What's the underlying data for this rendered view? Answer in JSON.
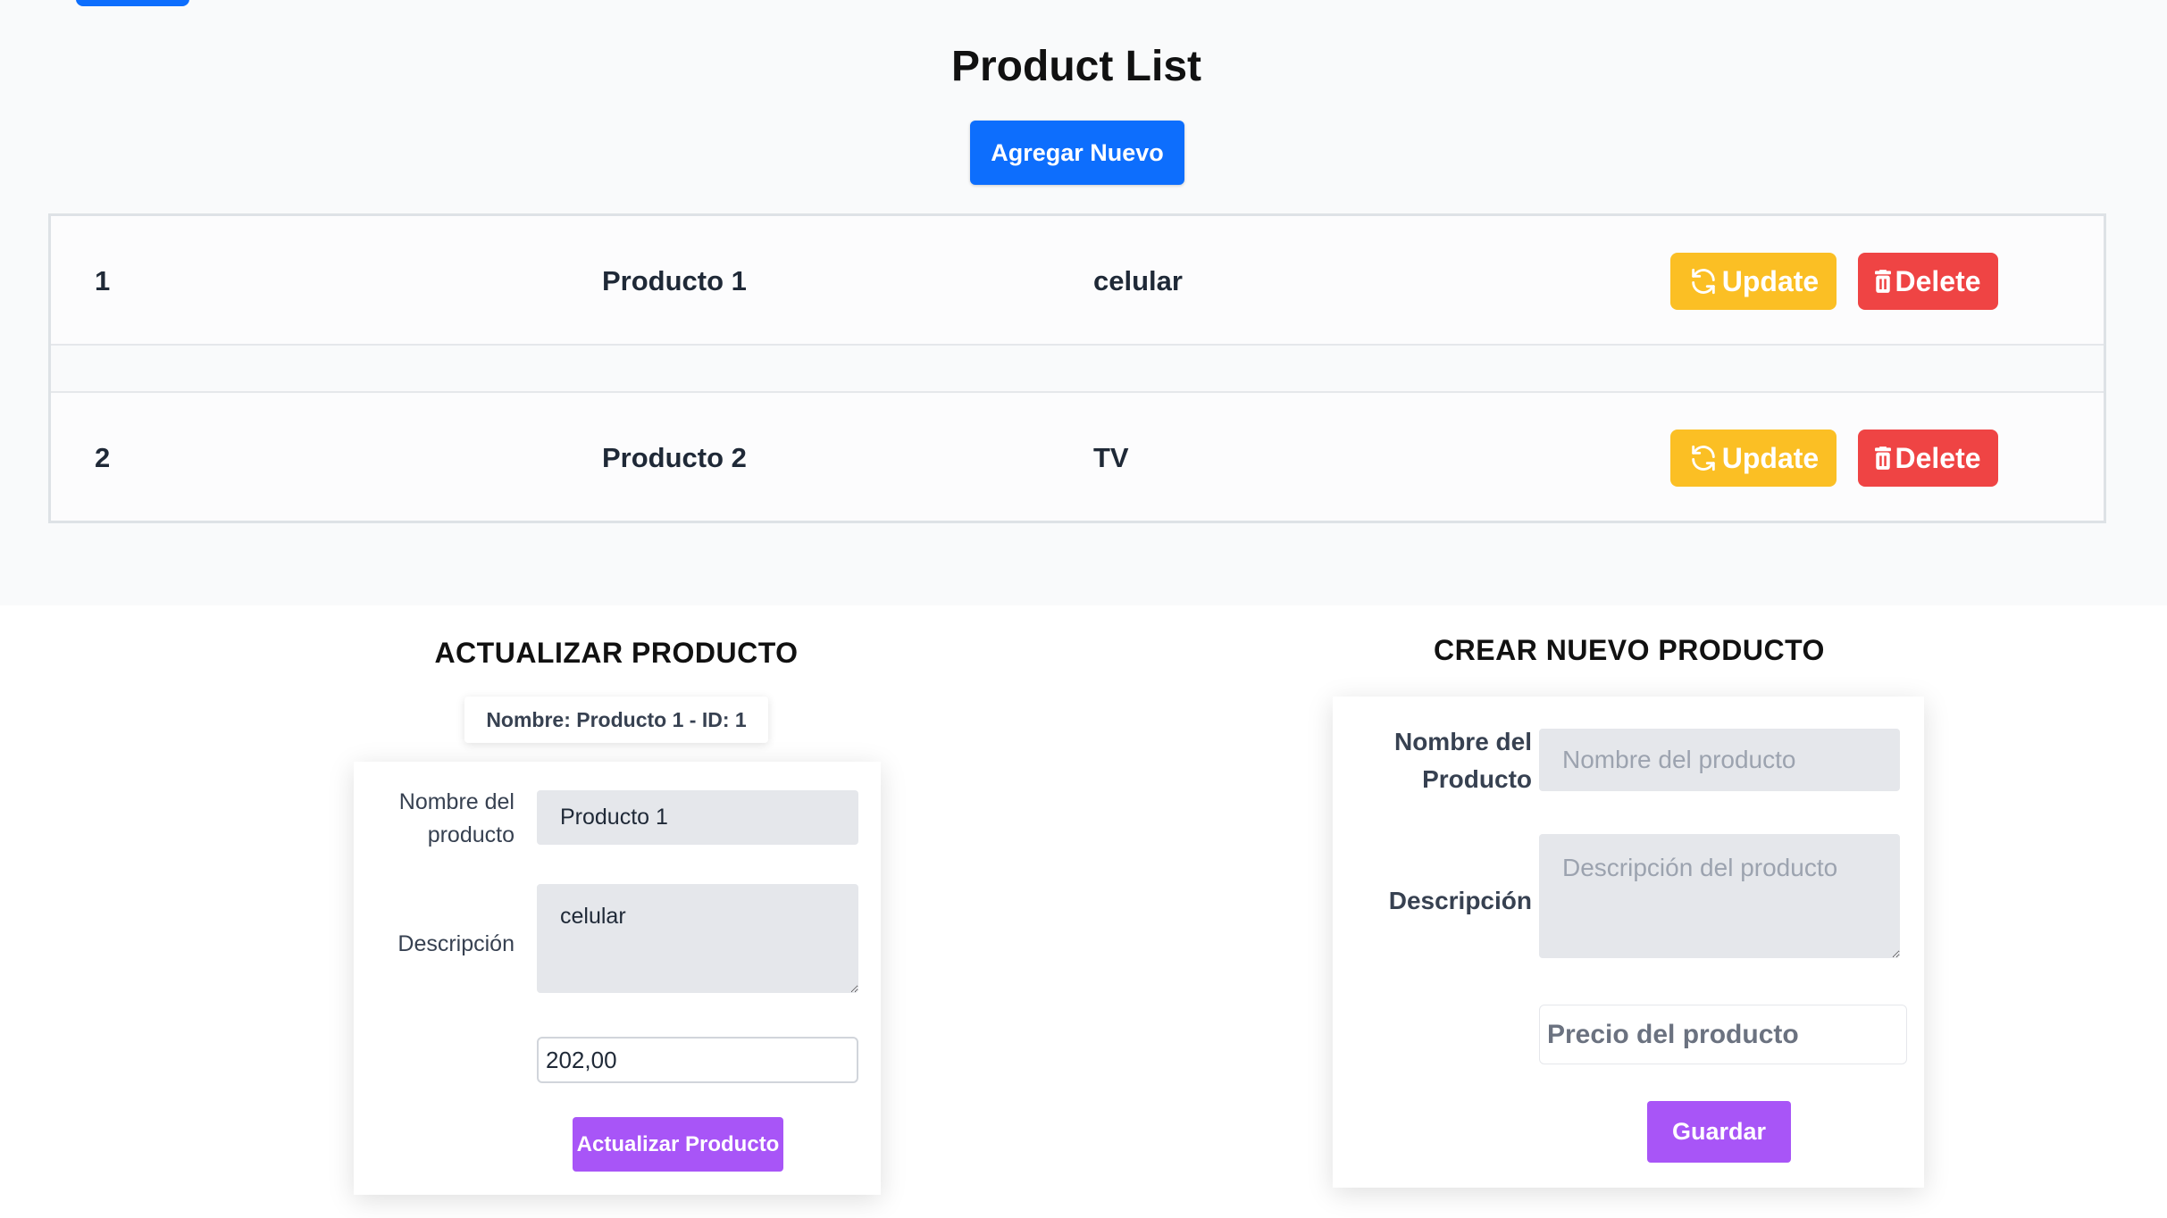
{
  "page": {
    "title": "Product List",
    "add_button": "Agregar Nuevo"
  },
  "products": [
    {
      "id": "1",
      "name": "Producto 1",
      "description": "celular",
      "update_label": "Update",
      "delete_label": "Delete"
    },
    {
      "id": "2",
      "name": "Producto 2",
      "description": "TV",
      "update_label": "Update",
      "delete_label": "Delete"
    }
  ],
  "update_form": {
    "title": "ACTUALIZAR PRODUCTO",
    "badge": "Nombre: Producto 1 - ID: 1",
    "name_label": "Nombre del producto",
    "name_value": "Producto 1",
    "description_label": "Descripción",
    "description_value": "celular",
    "price_value": "202,00",
    "submit_label": "Actualizar Producto"
  },
  "create_form": {
    "title": "CREAR NUEVO PRODUCTO",
    "name_label": "Nombre del Producto",
    "name_placeholder": "Nombre del producto",
    "description_label": "Descripción",
    "description_placeholder": "Descripción del producto",
    "price_placeholder": "Precio del producto",
    "submit_label": "Guardar"
  },
  "colors": {
    "primary": "#0d6efd",
    "update": "#fbbf24",
    "delete": "#ef4444",
    "purple": "#a855f7"
  },
  "icons": {
    "update": "refresh-icon",
    "delete": "trash-icon"
  }
}
